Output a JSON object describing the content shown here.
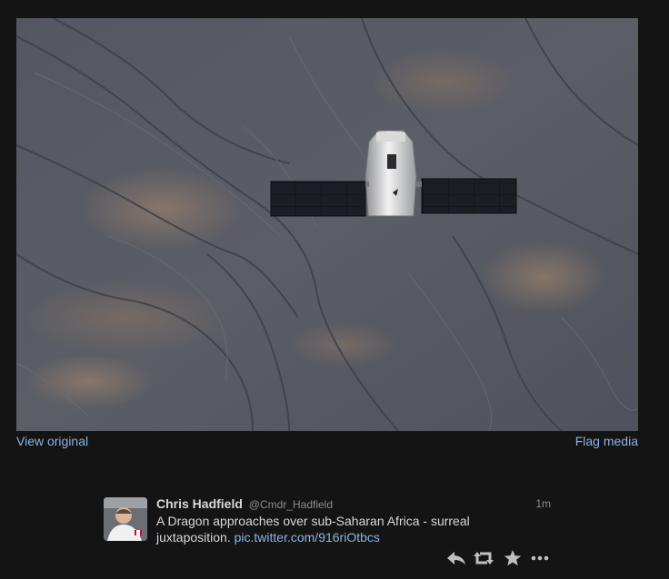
{
  "media": {
    "view_original_label": "View original",
    "flag_media_label": "Flag media"
  },
  "tweet": {
    "full_name": "Chris Hadfield",
    "screen_name": "@Cmdr_Hadfield",
    "timestamp": "1m",
    "text": "A Dragon approaches over sub-Saharan Africa - surreal juxtaposition. ",
    "link_text": "pic.twitter.com/916riOtbcs"
  },
  "actions": [
    {
      "icon": "reply-icon"
    },
    {
      "icon": "retweet-icon"
    },
    {
      "icon": "favorite-star-icon"
    },
    {
      "icon": "more-dots-icon"
    }
  ],
  "colors": {
    "background": "#141414",
    "link": "#8ab4e2",
    "text": "#d8d8d8",
    "muted": "#8c8c8c",
    "action_icon": "#bfbfbf"
  }
}
